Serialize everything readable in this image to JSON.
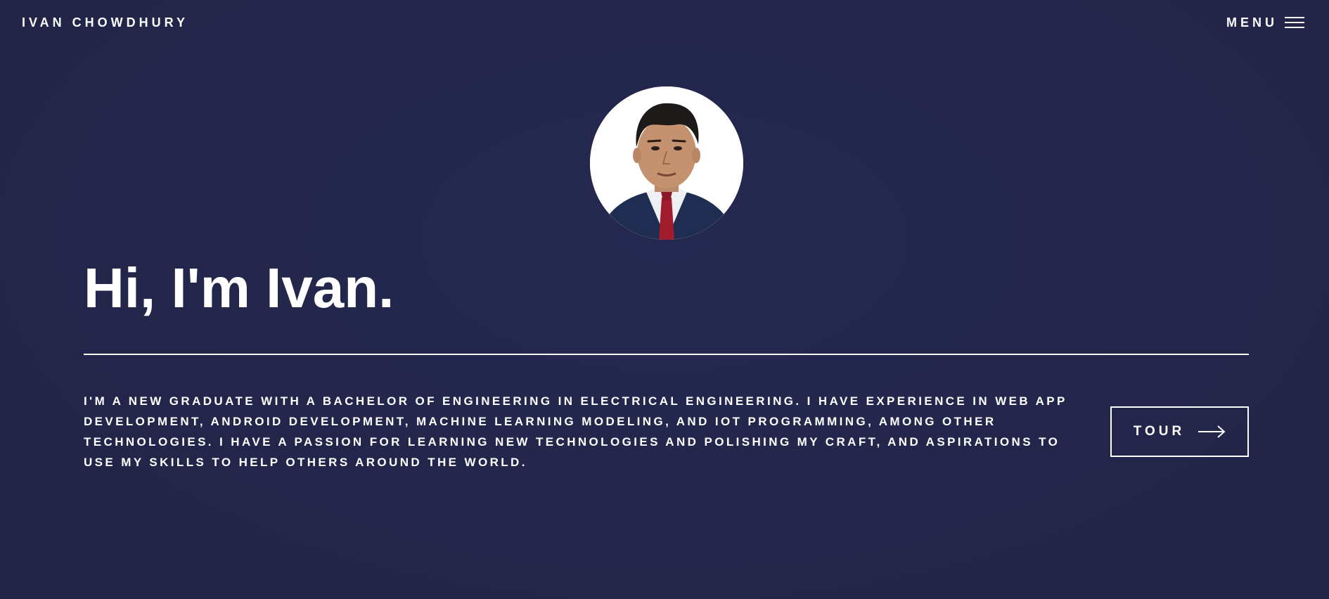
{
  "header": {
    "site_name": "IVAN CHOWDHURY",
    "menu_label": "MENU",
    "menu_icon": "hamburger-icon"
  },
  "hero": {
    "avatar_alt": "Portrait photo",
    "greeting": "Hi, I'm Ivan.",
    "intro": "I'm a new graduate with a Bachelor of Engineering in Electrical Engineering. I have experience in web app development, Android development, machine learning modeling, and IoT programming, among other technologies. I have a passion for learning new technologies and polishing my craft, and aspirations to use my skills to help others around the world.",
    "tour_label": "TOUR",
    "tour_icon": "arrow-right-icon"
  },
  "colors": {
    "background": "#23264a",
    "text": "#ffffff"
  }
}
